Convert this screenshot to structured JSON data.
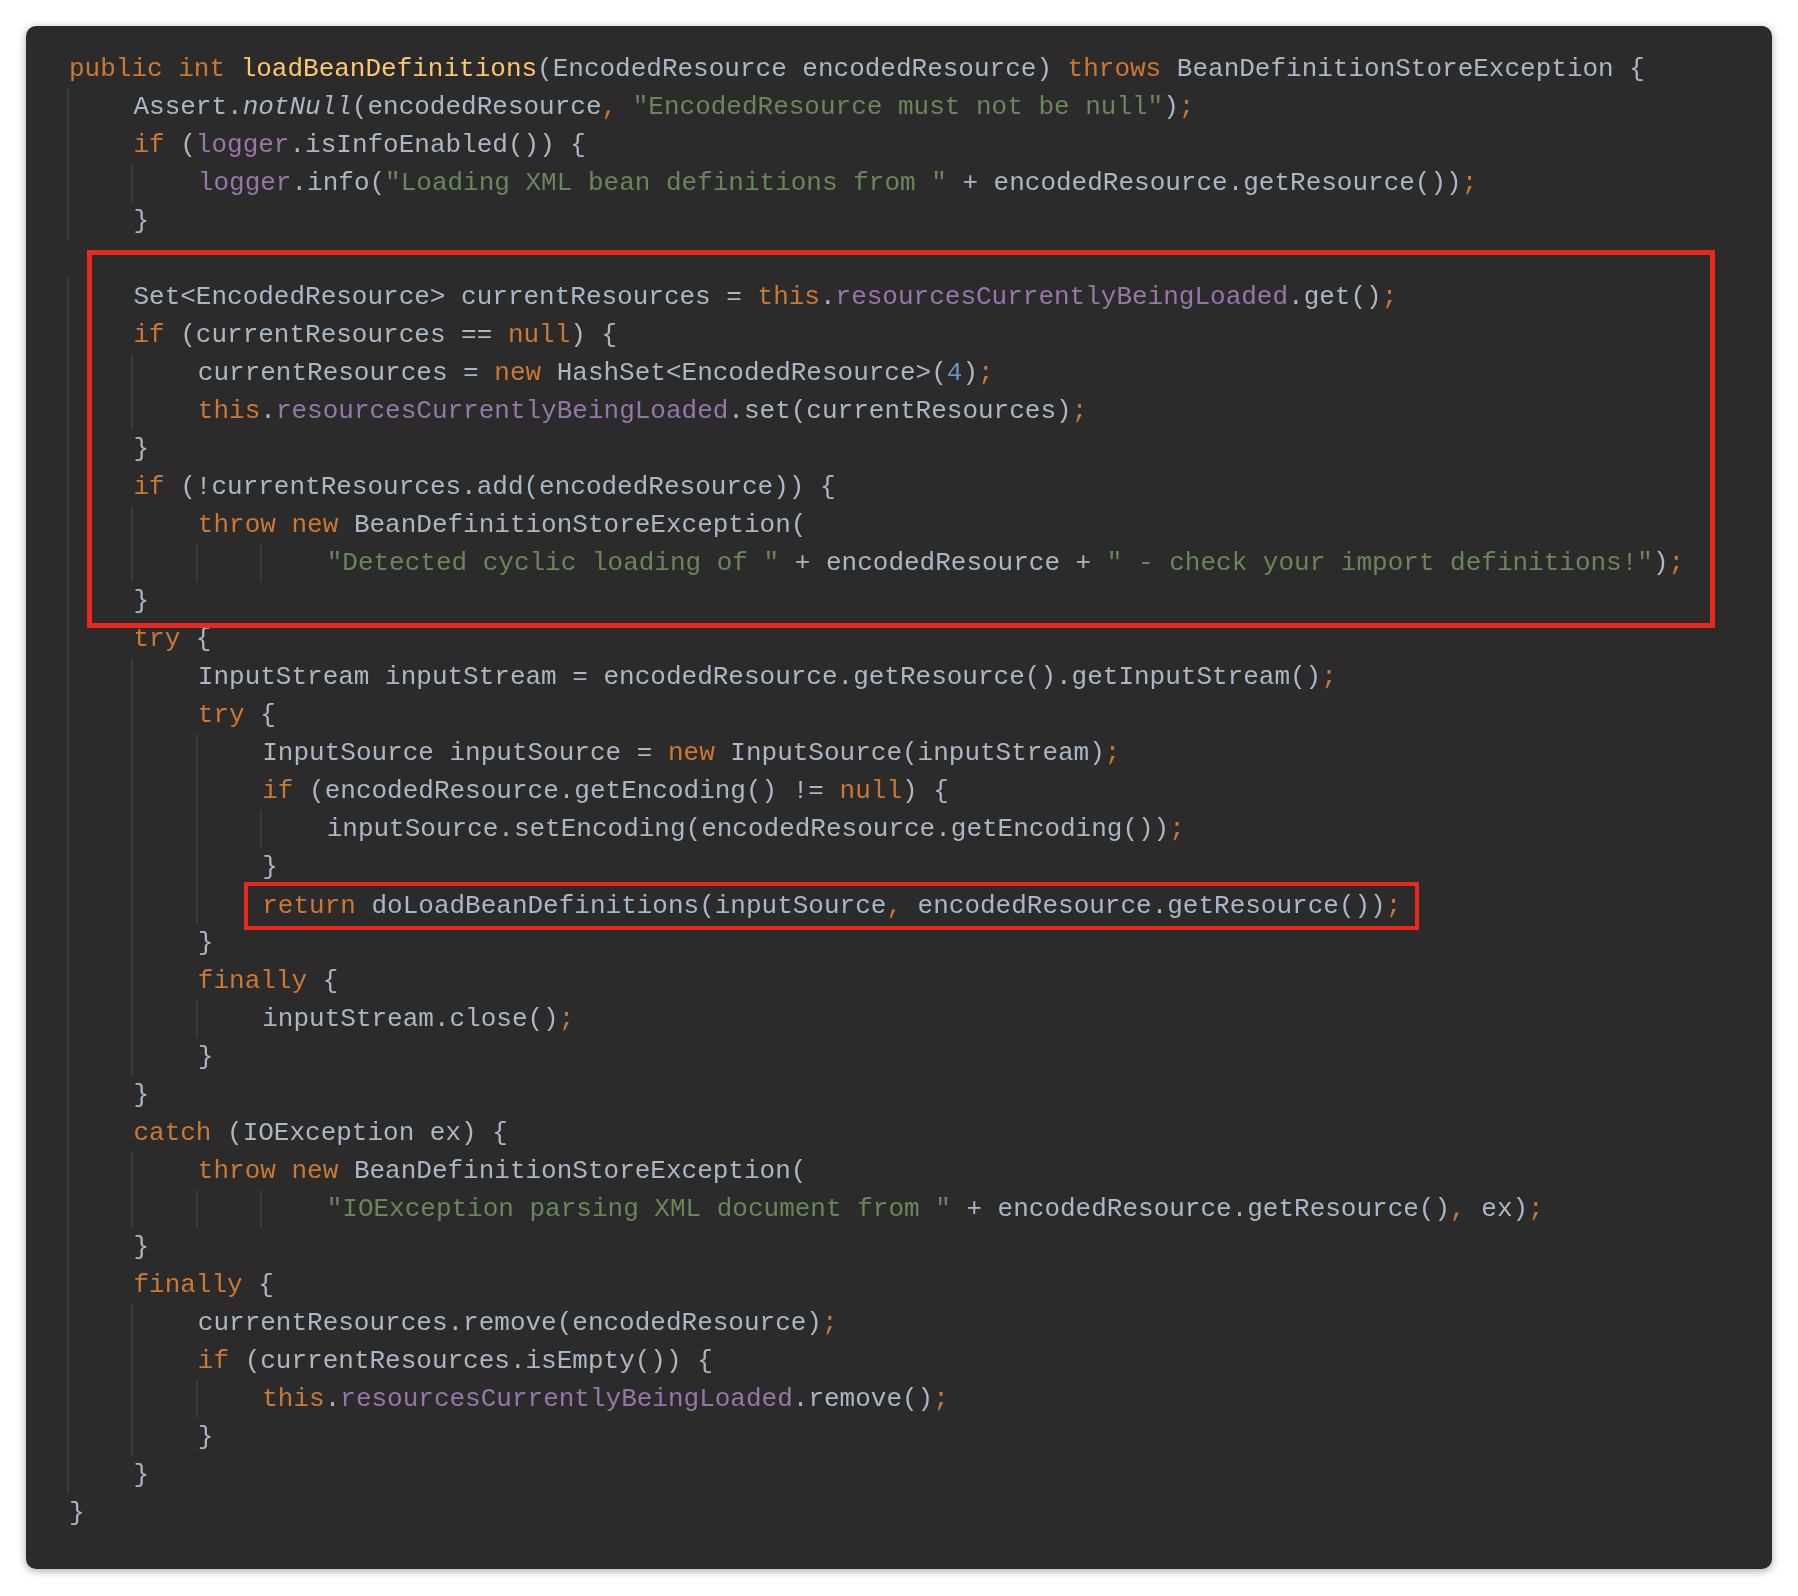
{
  "code": {
    "blocks": [
      {
        "boxed": false,
        "lines": [
          {
            "tokens": [
              {
                "kind": "keyword",
                "text": "public int "
              },
              {
                "kind": "declaration",
                "text": "loadBeanDefinitions"
              },
              {
                "kind": "plain",
                "text": "(EncodedResource encodedResource) "
              },
              {
                "kind": "keyword",
                "text": "throws"
              },
              {
                "kind": "plain",
                "text": " BeanDefinitionStoreException {"
              }
            ]
          },
          {
            "tokens": [
              {
                "kind": "plain",
                "text": "    Assert."
              },
              {
                "kind": "static",
                "text": "notNull"
              },
              {
                "kind": "plain",
                "text": "(encodedResource"
              },
              {
                "kind": "punct",
                "text": ", "
              },
              {
                "kind": "string",
                "text": "\"EncodedResource must not be null\""
              },
              {
                "kind": "plain",
                "text": ")"
              },
              {
                "kind": "punct",
                "text": ";"
              }
            ]
          },
          {
            "tokens": [
              {
                "kind": "keyword",
                "text": "    if"
              },
              {
                "kind": "plain",
                "text": " ("
              },
              {
                "kind": "field",
                "text": "logger"
              },
              {
                "kind": "plain",
                "text": ".isInfoEnabled()) {"
              }
            ]
          },
          {
            "tokens": [
              {
                "kind": "field",
                "text": "        logger"
              },
              {
                "kind": "plain",
                "text": ".info("
              },
              {
                "kind": "string",
                "text": "\"Loading XML bean definitions from \""
              },
              {
                "kind": "plain",
                "text": " + encodedResource.getResource())"
              },
              {
                "kind": "punct",
                "text": ";"
              }
            ]
          },
          {
            "tokens": [
              {
                "kind": "plain",
                "text": "    }"
              }
            ]
          }
        ]
      },
      {
        "boxed": true,
        "lines": [
          {
            "tokens": [
              {
                "kind": "plain",
                "text": "    Set<EncodedResource> currentResources = "
              },
              {
                "kind": "keyword",
                "text": "this"
              },
              {
                "kind": "plain",
                "text": "."
              },
              {
                "kind": "field",
                "text": "resourcesCurrentlyBeingLoaded"
              },
              {
                "kind": "plain",
                "text": ".get()"
              },
              {
                "kind": "punct",
                "text": ";"
              }
            ]
          },
          {
            "tokens": [
              {
                "kind": "keyword",
                "text": "    if"
              },
              {
                "kind": "plain",
                "text": " (currentResources == "
              },
              {
                "kind": "keyword",
                "text": "null"
              },
              {
                "kind": "plain",
                "text": ") {"
              }
            ]
          },
          {
            "tokens": [
              {
                "kind": "plain",
                "text": "        currentResources = "
              },
              {
                "kind": "keyword",
                "text": "new"
              },
              {
                "kind": "plain",
                "text": " HashSet<EncodedResource>("
              },
              {
                "kind": "number",
                "text": "4"
              },
              {
                "kind": "plain",
                "text": ")"
              },
              {
                "kind": "punct",
                "text": ";"
              }
            ]
          },
          {
            "tokens": [
              {
                "kind": "keyword",
                "text": "        this"
              },
              {
                "kind": "plain",
                "text": "."
              },
              {
                "kind": "field",
                "text": "resourcesCurrentlyBeingLoaded"
              },
              {
                "kind": "plain",
                "text": ".set(currentResources)"
              },
              {
                "kind": "punct",
                "text": ";"
              }
            ]
          },
          {
            "tokens": [
              {
                "kind": "plain",
                "text": "    }"
              }
            ]
          },
          {
            "tokens": [
              {
                "kind": "keyword",
                "text": "    if"
              },
              {
                "kind": "plain",
                "text": " (!currentResources.add(encodedResource)) {"
              }
            ]
          },
          {
            "tokens": [
              {
                "kind": "keyword",
                "text": "        throw new"
              },
              {
                "kind": "plain",
                "text": " BeanDefinitionStoreException("
              }
            ]
          },
          {
            "tokens": [
              {
                "kind": "string",
                "text": "                \"Detected cyclic loading of \""
              },
              {
                "kind": "plain",
                "text": " + encodedResource + "
              },
              {
                "kind": "string",
                "text": "\" - check your import definitions!\""
              },
              {
                "kind": "plain",
                "text": ")"
              },
              {
                "kind": "punct",
                "text": ";"
              }
            ]
          },
          {
            "tokens": [
              {
                "kind": "plain",
                "text": "    }"
              }
            ]
          }
        ]
      },
      {
        "boxed": false,
        "lines": [
          {
            "tokens": [
              {
                "kind": "keyword",
                "text": "    try"
              },
              {
                "kind": "plain",
                "text": " {"
              }
            ]
          },
          {
            "tokens": [
              {
                "kind": "plain",
                "text": "        InputStream inputStream = encodedResource.getResource().getInputStream()"
              },
              {
                "kind": "punct",
                "text": ";"
              }
            ]
          },
          {
            "tokens": [
              {
                "kind": "keyword",
                "text": "        try"
              },
              {
                "kind": "plain",
                "text": " {"
              }
            ]
          },
          {
            "tokens": [
              {
                "kind": "plain",
                "text": "            InputSource inputSource = "
              },
              {
                "kind": "keyword",
                "text": "new"
              },
              {
                "kind": "plain",
                "text": " InputSource(inputStream)"
              },
              {
                "kind": "punct",
                "text": ";"
              }
            ]
          },
          {
            "tokens": [
              {
                "kind": "keyword",
                "text": "            if"
              },
              {
                "kind": "plain",
                "text": " (encodedResource.getEncoding() != "
              },
              {
                "kind": "keyword",
                "text": "null"
              },
              {
                "kind": "plain",
                "text": ") {"
              }
            ]
          },
          {
            "tokens": [
              {
                "kind": "plain",
                "text": "                inputSource.setEncoding(encodedResource.getEncoding())"
              },
              {
                "kind": "punct",
                "text": ";"
              }
            ]
          },
          {
            "tokens": [
              {
                "kind": "plain",
                "text": "            }"
              }
            ]
          }
        ]
      },
      {
        "boxed": true,
        "lines": [
          {
            "tokens": [
              {
                "kind": "keyword",
                "text": "            return"
              },
              {
                "kind": "plain",
                "text": " doLoadBeanDefinitions(inputSource"
              },
              {
                "kind": "punct",
                "text": ", "
              },
              {
                "kind": "plain",
                "text": "encodedResource.getResource())"
              },
              {
                "kind": "punct",
                "text": ";"
              }
            ]
          }
        ]
      },
      {
        "boxed": false,
        "lines": [
          {
            "tokens": [
              {
                "kind": "plain",
                "text": "        }"
              }
            ]
          },
          {
            "tokens": [
              {
                "kind": "keyword",
                "text": "        finally"
              },
              {
                "kind": "plain",
                "text": " {"
              }
            ]
          },
          {
            "tokens": [
              {
                "kind": "plain",
                "text": "            inputStream.close()"
              },
              {
                "kind": "punct",
                "text": ";"
              }
            ]
          },
          {
            "tokens": [
              {
                "kind": "plain",
                "text": "        }"
              }
            ]
          },
          {
            "tokens": [
              {
                "kind": "plain",
                "text": "    }"
              }
            ]
          },
          {
            "tokens": [
              {
                "kind": "keyword",
                "text": "    catch"
              },
              {
                "kind": "plain",
                "text": " (IOException ex) {"
              }
            ]
          },
          {
            "tokens": [
              {
                "kind": "keyword",
                "text": "        throw new"
              },
              {
                "kind": "plain",
                "text": " BeanDefinitionStoreException("
              }
            ]
          },
          {
            "tokens": [
              {
                "kind": "string",
                "text": "                \"IOException parsing XML document from \""
              },
              {
                "kind": "plain",
                "text": " + encodedResource.getResource()"
              },
              {
                "kind": "punct",
                "text": ", "
              },
              {
                "kind": "plain",
                "text": "ex)"
              },
              {
                "kind": "punct",
                "text": ";"
              }
            ]
          },
          {
            "tokens": [
              {
                "kind": "plain",
                "text": "    }"
              }
            ]
          },
          {
            "tokens": [
              {
                "kind": "keyword",
                "text": "    finally"
              },
              {
                "kind": "plain",
                "text": " {"
              }
            ]
          },
          {
            "tokens": [
              {
                "kind": "plain",
                "text": "        currentResources.remove(encodedResource)"
              },
              {
                "kind": "punct",
                "text": ";"
              }
            ]
          },
          {
            "tokens": [
              {
                "kind": "keyword",
                "text": "        if"
              },
              {
                "kind": "plain",
                "text": " (currentResources.isEmpty()) {"
              }
            ]
          },
          {
            "tokens": [
              {
                "kind": "keyword",
                "text": "            this"
              },
              {
                "kind": "plain",
                "text": "."
              },
              {
                "kind": "field",
                "text": "resourcesCurrentlyBeingLoaded"
              },
              {
                "kind": "plain",
                "text": ".remove()"
              },
              {
                "kind": "punct",
                "text": ";"
              }
            ]
          },
          {
            "tokens": [
              {
                "kind": "plain",
                "text": "        }"
              }
            ]
          },
          {
            "tokens": [
              {
                "kind": "plain",
                "text": "    }"
              }
            ]
          },
          {
            "tokens": [
              {
                "kind": "plain",
                "text": "}"
              }
            ]
          }
        ]
      }
    ]
  }
}
